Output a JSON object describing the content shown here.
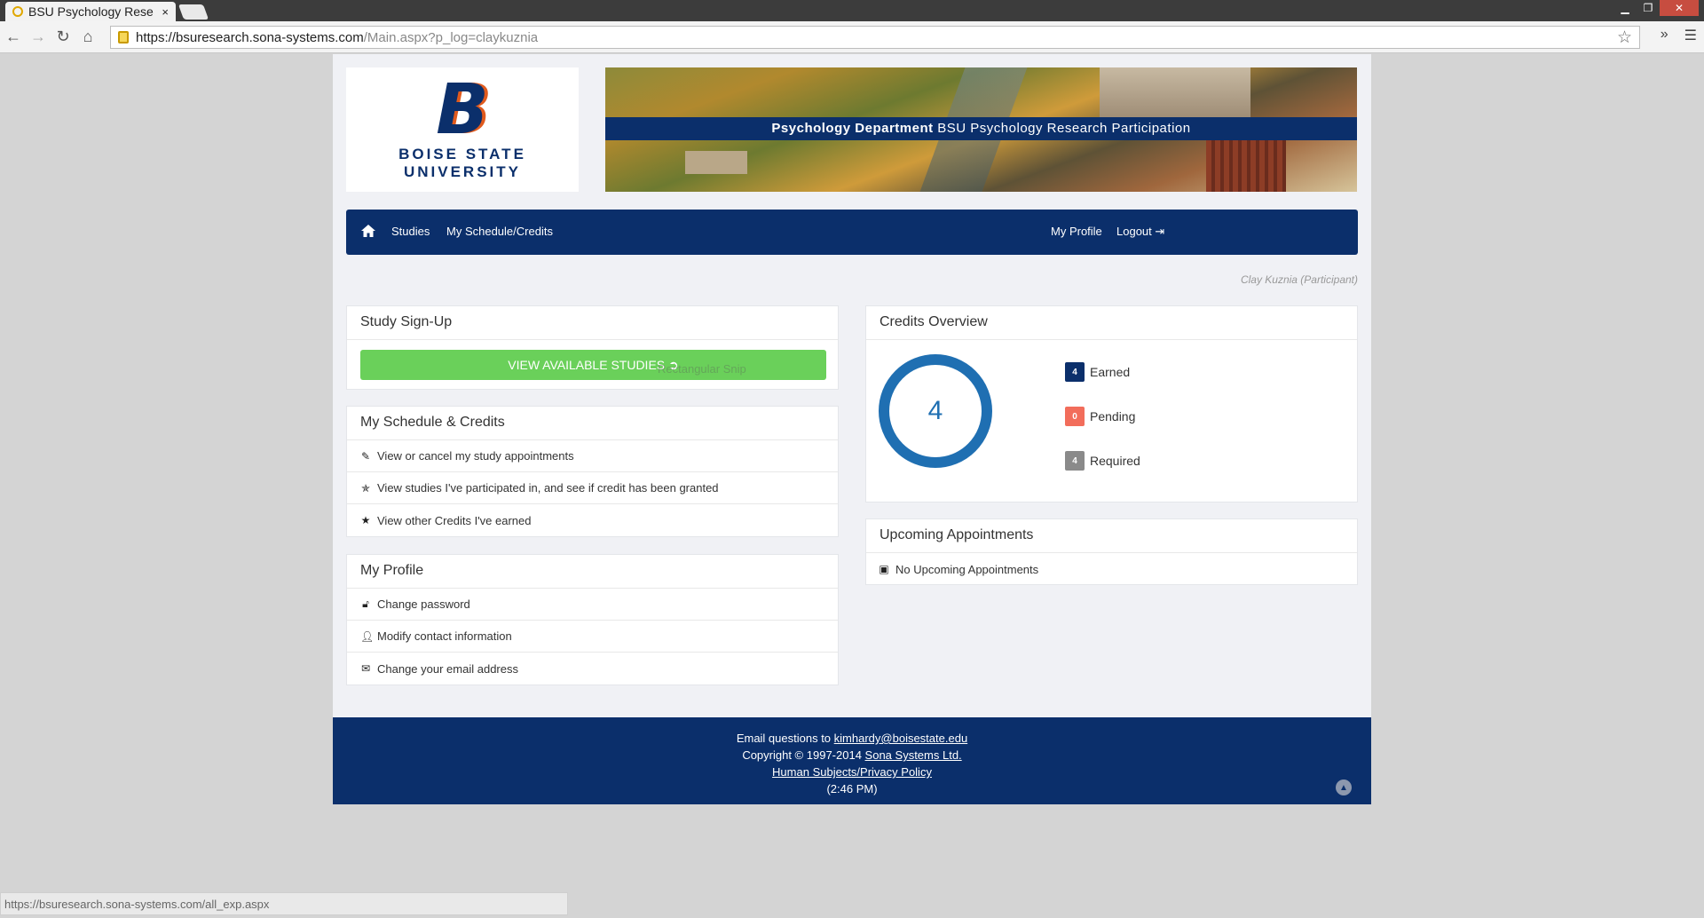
{
  "browser": {
    "tab_title": "BSU Psychology Rese",
    "tab_close": "×",
    "url_main": "https://bsuresearch.sona-systems.com",
    "url_rest": "/Main.aspx?p_log=claykuznia",
    "status_url": "https://bsuresearch.sona-systems.com/all_exp.aspx"
  },
  "header": {
    "logo_letter": "B",
    "logo_line1": "BOISE STATE",
    "logo_line2": "UNIVERSITY",
    "banner_dept": "Psychology Department",
    "banner_title": "BSU Psychology Research Participation"
  },
  "nav": {
    "studies": "Studies",
    "schedule": "My Schedule/Credits",
    "profile": "My Profile",
    "logout": "Logout"
  },
  "participant": "Clay Kuznia (Participant)",
  "signup": {
    "title": "Study Sign-Up",
    "button": "VIEW AVAILABLE STUDIES",
    "overlay_text": "Rectangular Snip"
  },
  "schedule": {
    "title": "My Schedule & Credits",
    "items": [
      {
        "label": "View or cancel my study appointments",
        "icon": "edit-icon"
      },
      {
        "label": "View studies I've participated in, and see if credit has been granted",
        "icon": "half-star-icon"
      },
      {
        "label": "View other Credits I've earned",
        "icon": "star-icon"
      }
    ]
  },
  "profile": {
    "title": "My Profile",
    "items": [
      {
        "label": "Change password",
        "icon": "lock-icon"
      },
      {
        "label": "Modify contact information",
        "icon": "user-icon"
      },
      {
        "label": "Change your email address",
        "icon": "envelope-icon"
      }
    ]
  },
  "credits": {
    "title": "Credits Overview",
    "total": "4",
    "earned_count": "4",
    "earned_label": "Earned",
    "pending_count": "0",
    "pending_label": "Pending",
    "required_count": "4",
    "required_label": "Required",
    "colors": {
      "earned": "#0b2f6b",
      "pending": "#f26d5b",
      "required": "#8a8a8a",
      "ring": "#1f6fb2"
    }
  },
  "appointments": {
    "title": "Upcoming Appointments",
    "empty": "No Upcoming Appointments"
  },
  "footer": {
    "email_prefix": "Email questions to",
    "email": "kimhardy@boisestate.edu",
    "copyright": "Copyright © 1997-2014",
    "company": "Sona Systems Ltd.",
    "policy": "Human Subjects/Privacy Policy",
    "time": "(2:46 PM)"
  },
  "colors": {
    "brand": "#0b2f6b",
    "accent": "#e05a1d",
    "button": "#6ad05a"
  }
}
